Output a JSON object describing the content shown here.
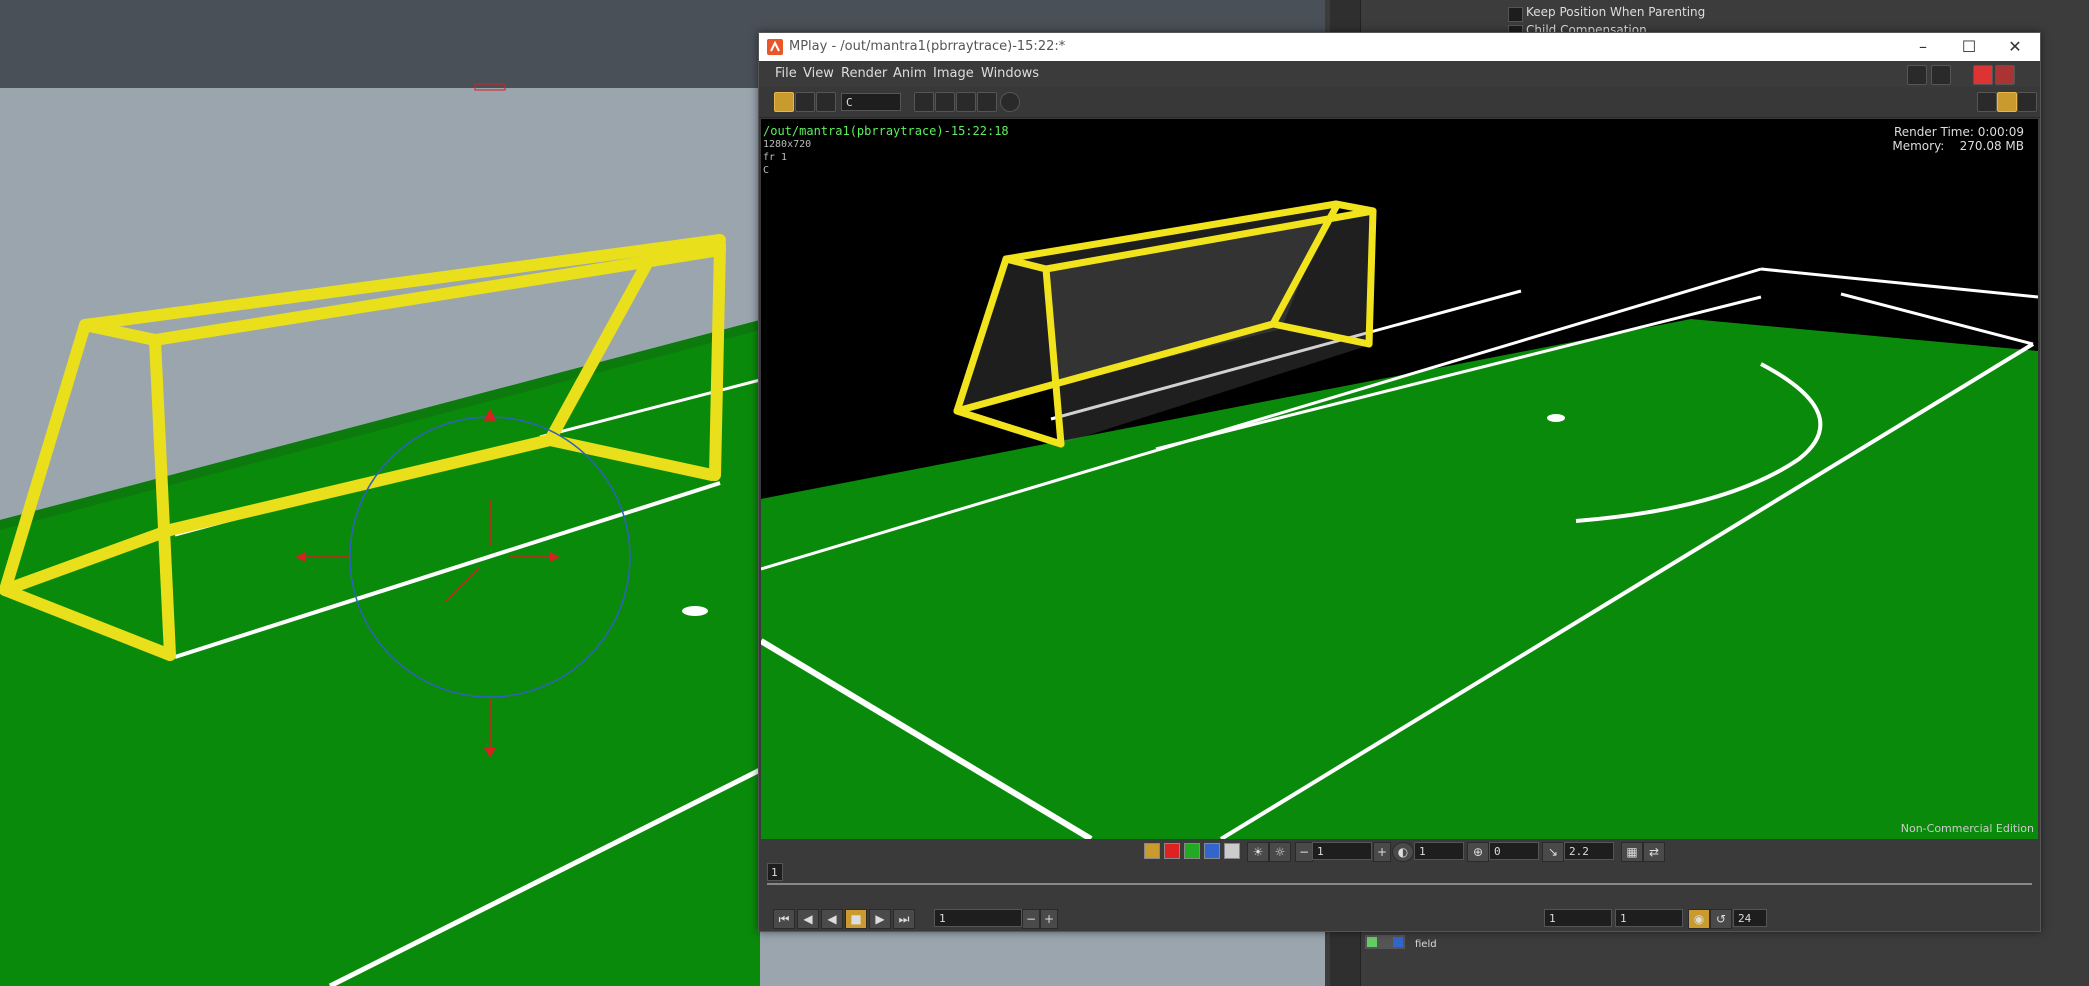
{
  "mplay": {
    "title": "MPlay - /out/mantra1(pbrraytrace)-15:22:*",
    "menu": [
      "File",
      "View",
      "Render",
      "Anim",
      "Image",
      "Windows"
    ],
    "channel": "C",
    "overlay": {
      "path": "/out/mantra1(pbrraytrace)-15:22:18",
      "resolution": "1280x720",
      "frame": "fr 1",
      "channel": "C",
      "render_time": "Render Time: 0:00:09",
      "memory": "Memory:    270.08 MB",
      "edition": "Non-Commercial Edition"
    },
    "display": {
      "exposure": "1",
      "gamma_like": "1",
      "offset": "0",
      "gamma": "2.2"
    },
    "timeline": {
      "frame_marker": "1",
      "current_frame": "1",
      "start": "1",
      "end": "1",
      "fps": "24"
    }
  },
  "right_panel": {
    "keep_position": "Keep Position When Parenting",
    "child_comp": "Child Compensation",
    "node_label": "field"
  },
  "colors": {
    "accent": "#c99a2e",
    "field_green": "#0a8a0a",
    "goal_yellow": "#f0e020"
  }
}
